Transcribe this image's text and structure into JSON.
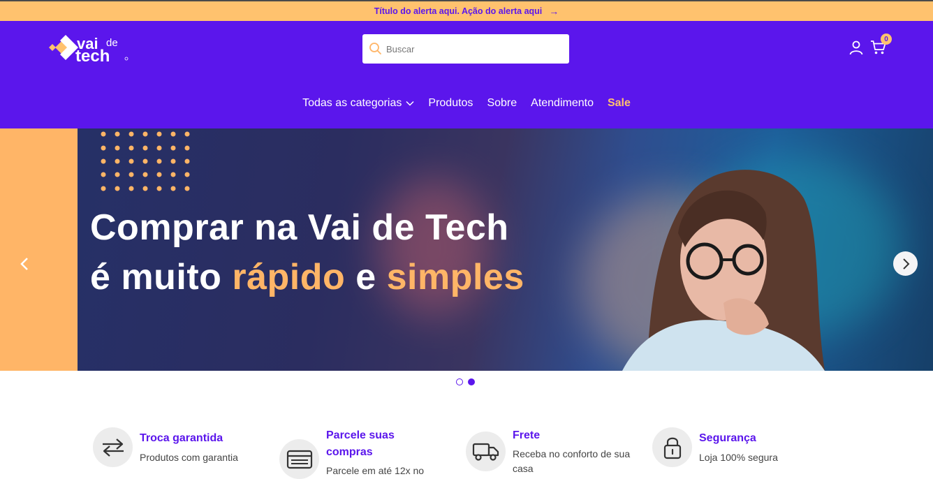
{
  "alert": {
    "text": "Título do alerta aqui. Ação do alerta aqui",
    "arrow": "→"
  },
  "logo": {
    "line1": "vai",
    "line2": "de",
    "line3": "tech"
  },
  "search": {
    "placeholder": "Buscar"
  },
  "cart": {
    "count": "0"
  },
  "nav": {
    "items": [
      {
        "label": "Todas as categorias"
      },
      {
        "label": "Produtos"
      },
      {
        "label": "Sobre"
      },
      {
        "label": "Atendimento"
      },
      {
        "label": "Sale"
      }
    ]
  },
  "hero": {
    "line1": "Comprar na Vai de Tech",
    "line2_a": "é muito ",
    "line2_b": "rápido",
    "line2_c": " e ",
    "line2_d": "simples"
  },
  "carousel": {
    "slides": 2,
    "active": 2
  },
  "features": [
    {
      "icon": "exchange-arrows-icon",
      "title": "Troca garantida",
      "desc": "Produtos com garantia"
    },
    {
      "icon": "credit-card-icon",
      "title": "Parcele suas compras",
      "desc": "Parcele em até 12x no"
    },
    {
      "icon": "delivery-truck-icon",
      "title": "Frete",
      "desc": "Receba no conforto de sua casa"
    },
    {
      "icon": "padlock-icon",
      "title": "Segurança",
      "desc": "Loja 100% segura"
    }
  ],
  "colors": {
    "brand": "#5b16ec",
    "accent": "#ffc26e",
    "hero_side": "#ffb567"
  }
}
